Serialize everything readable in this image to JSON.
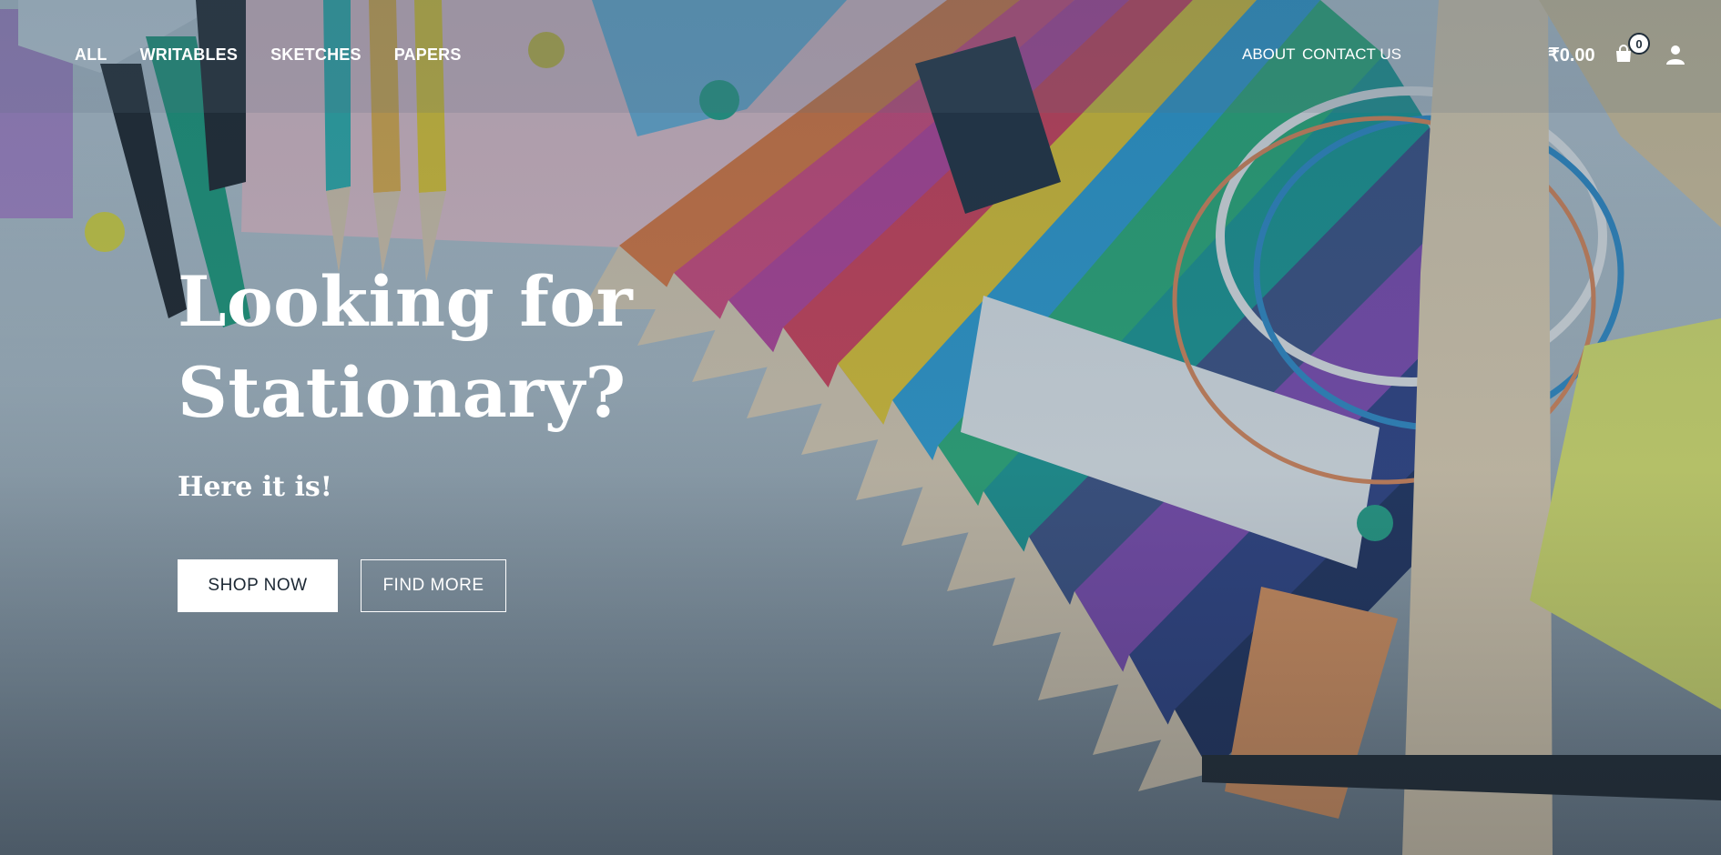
{
  "nav": {
    "left_items": [
      "ALL",
      "WRITABLES",
      "SKETCHES",
      "PAPERS"
    ],
    "about": "ABOUT",
    "contact": "CONTACT US",
    "cart_total": "₹0.00",
    "cart_count": "0",
    "icons": [
      "shopping-bag-icon",
      "user-icon"
    ]
  },
  "hero": {
    "headline_line1": "Looking for",
    "headline_line2": "Stationary?",
    "subheadline": "Here it is!",
    "primary_button": "SHOP NOW",
    "secondary_button": "FIND MORE"
  },
  "colors": {
    "text": "#ffffff",
    "button_text": "#1b2733",
    "overlay": "#3a5568"
  }
}
